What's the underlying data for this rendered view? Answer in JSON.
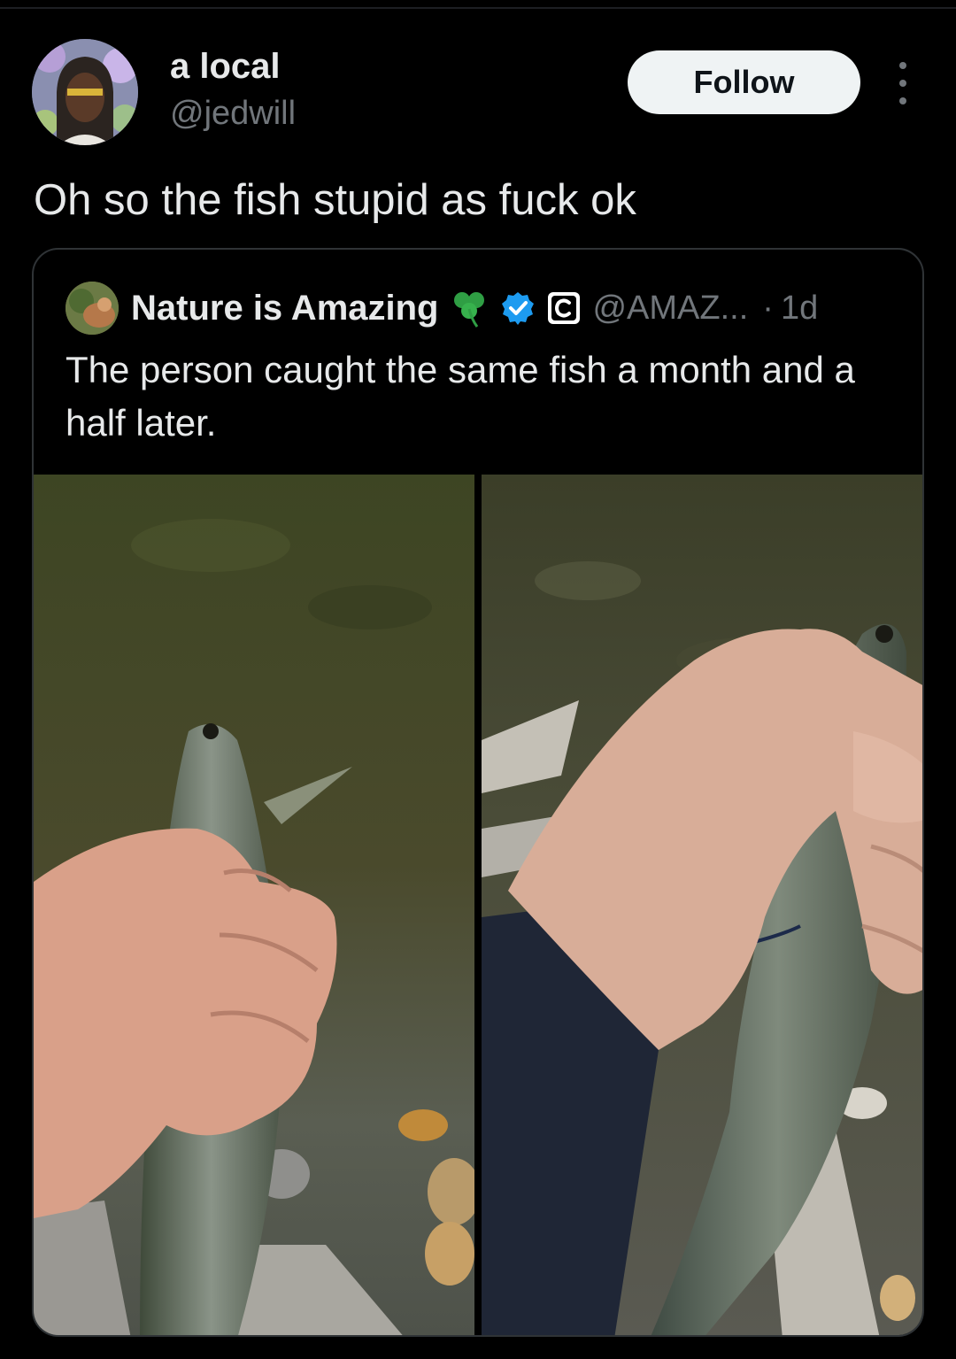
{
  "author": {
    "display_name": "a local",
    "handle": "@jedwill",
    "avatar": "user-avatar-photo"
  },
  "actions": {
    "follow_label": "Follow",
    "more_icon": "more-vertical-icon"
  },
  "tweet": {
    "text": "Oh so the fish stupid as fuck ok"
  },
  "quoted_tweet": {
    "display_name": "Nature is Amazing",
    "badges": [
      "clover-icon",
      "verified-icon",
      "affiliate-badge-icon"
    ],
    "handle": "@AMAZ...",
    "separator": "·",
    "time": "1d",
    "text": "The person caught the same fish a month and a half later.",
    "media": [
      "fish-photo-first-catch",
      "fish-photo-second-catch"
    ]
  },
  "colors": {
    "background": "#000000",
    "primary_text": "#e7e9ea",
    "secondary_text": "#71767b",
    "follow_bg": "#eff3f4",
    "verified_blue": "#1d9bf0",
    "clover_green": "#2f9e44"
  }
}
